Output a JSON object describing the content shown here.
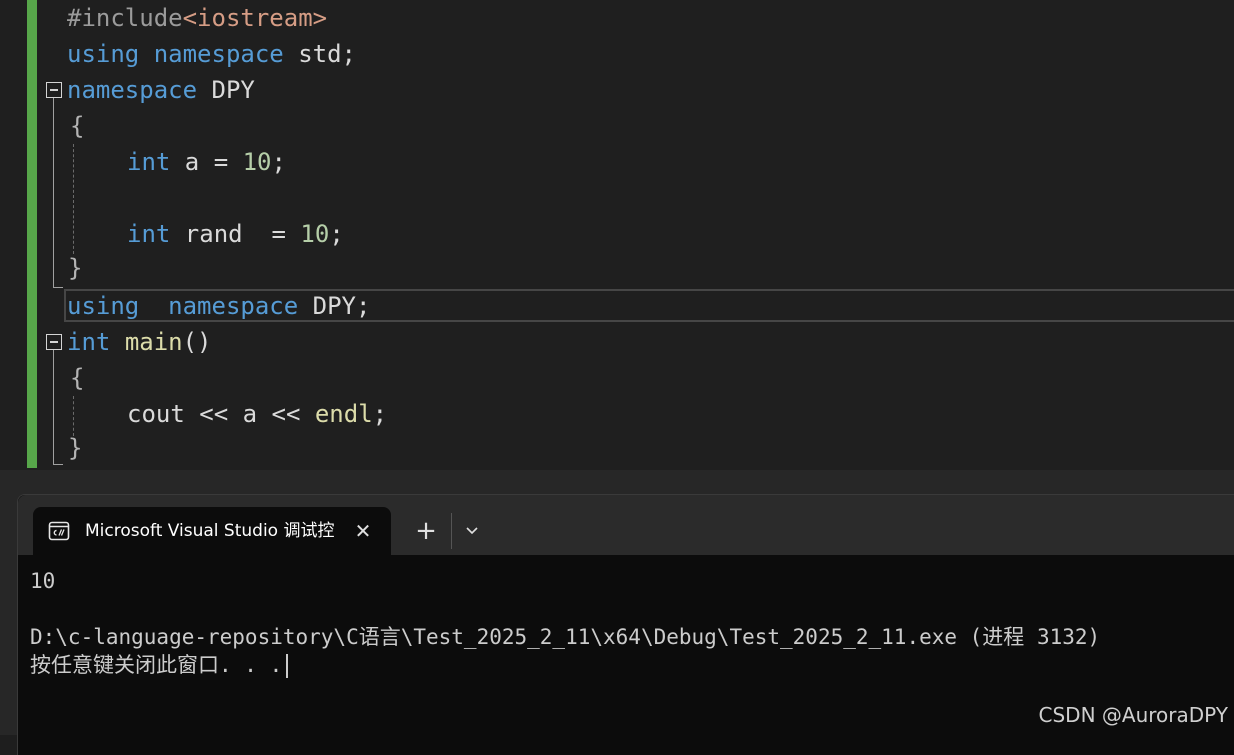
{
  "editor": {
    "lines": {
      "l1": {
        "pp": "#include",
        "inc": "<iostream>"
      },
      "l2": {
        "kw1": "using",
        "kw2": "namespace",
        "rest": " std;"
      },
      "l3": {
        "kw": "namespace",
        "rest": " DPY"
      },
      "l4": {
        "text": "{"
      },
      "l5": {
        "kw": "int",
        "mid": " a = ",
        "num": "10",
        "end": ";"
      },
      "l7": {
        "kw": "int",
        "mid": " rand  = ",
        "num": "10",
        "end": ";"
      },
      "l8": {
        "text": "}"
      },
      "l9": {
        "kw1": "using",
        "kw2": "namespace",
        "rest": " DPY;"
      },
      "l10": {
        "kw": "int",
        "fn": "main",
        "rest": "()"
      },
      "l11": {
        "text": "{"
      },
      "l12": {
        "fn1": "cout",
        "mid1": " << a << ",
        "fn2": "endl",
        "end": ";"
      },
      "l13": {
        "text": "}"
      }
    }
  },
  "terminal": {
    "tab_title": "Microsoft Visual Studio 调试控制台",
    "close_glyph": "✕",
    "new_tab_glyph": "+",
    "output": {
      "line1": "10",
      "line2": "D:\\c-language-repository\\C语言\\Test_2025_2_11\\x64\\Debug\\Test_2025_2_11.exe (进程 3132)",
      "line3": "按任意键关闭此窗口. . ."
    }
  },
  "watermark": "CSDN @AuroraDPY",
  "colors": {
    "keyword": "#569cd6",
    "preprocessor": "#9b9b9b",
    "include_string": "#d69d85",
    "number": "#b5cea8",
    "function": "#dcdcaa",
    "change_bar": "#57a64a"
  }
}
